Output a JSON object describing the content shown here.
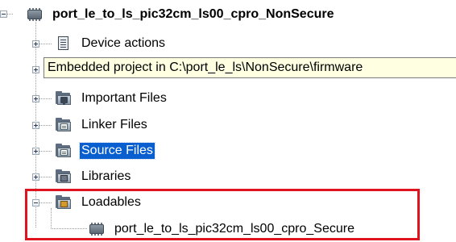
{
  "project": {
    "name": "port_le_to_ls_pic32cm_ls00_cpro_NonSecure"
  },
  "nodes": [
    {
      "id": "device-actions",
      "label": "Device actions",
      "icon": "device-actions-icon"
    },
    {
      "id": "important-files",
      "label": "Important Files",
      "icon": "important-folder-icon"
    },
    {
      "id": "linker-files",
      "label": "Linker Files",
      "icon": "linker-folder-icon"
    },
    {
      "id": "source-files",
      "label": "Source Files",
      "icon": "source-folder-icon",
      "selected": true
    },
    {
      "id": "libraries",
      "label": "Libraries",
      "icon": "libraries-folder-icon"
    },
    {
      "id": "loadables",
      "label": "Loadables",
      "icon": "loadables-folder-icon",
      "expanded": true
    }
  ],
  "loadable_child": {
    "label": "port_le_to_ls_pic32cm_ls00_cpro_Secure",
    "icon": "chip-project-icon"
  },
  "tooltip": {
    "text": "Embedded project in C:\\port_le_ls\\NonSecure\\firmware"
  },
  "colors": {
    "selection": "#0a5fd0",
    "highlight_border": "#e0141e",
    "tooltip_bg": "#ffffe1"
  }
}
